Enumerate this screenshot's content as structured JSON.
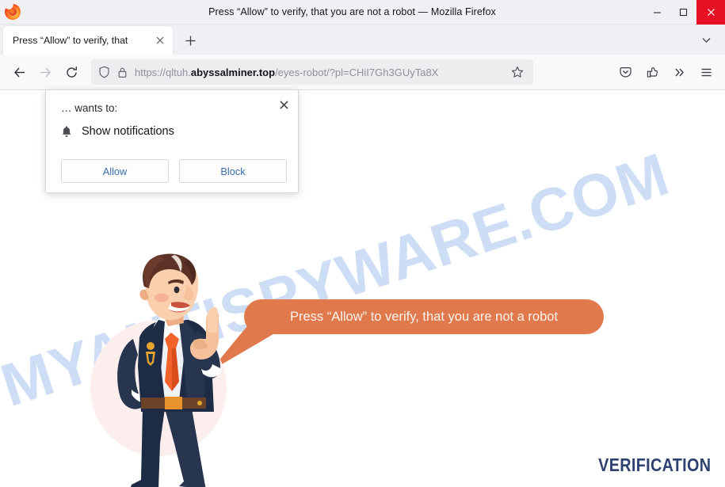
{
  "window": {
    "title": "Press “Allow” to verify, that you are not a robot — Mozilla Firefox",
    "app_icon": "firefox-logo",
    "minimize_label": "Minimize",
    "maximize_label": "Maximize",
    "close_label": "Close",
    "close_button_color": "#e81123"
  },
  "tabbar": {
    "tab_title": "Press “Allow” to verify, that",
    "tab_close_label": "Close tab",
    "new_tab_label": "New tab",
    "list_all_tabs_label": "List all tabs"
  },
  "toolbar": {
    "back_label": "Go back one page",
    "forward_label": "Go forward one page",
    "reload_label": "Reload current page",
    "shield_label": "Tracking protection",
    "lock_label": "Connection secure",
    "bookmark_label": "Bookmark this page",
    "pocket_label": "Save to Pocket",
    "share_label": "Share",
    "overflow_label": "More tools",
    "menu_label": "Open application menu",
    "url": {
      "scheme": "https://",
      "subdomain": "qltuh.",
      "host": "abyssalminer.top",
      "path": "/eyes-robot/?pl=CHiI7Gh3GUyTa8X",
      "full": "https://qltuh.abyssalminer.top/eyes-robot/?pl=CHiI7Gh3GUyTa8X"
    }
  },
  "permission_popup": {
    "origin_text": "… wants to:",
    "permission_icon": "bell-icon",
    "permission_label": "Show notifications",
    "allow_label": "Allow",
    "block_label": "Block",
    "close_label": "Close",
    "button_text_color": "#3a6ea8"
  },
  "page": {
    "watermark": "MYANTISPYWARE.COM",
    "watermark_color": "#c3d6f3",
    "bubble_text": "Press “Allow” to verify, that you are not a robot",
    "bubble_color": "#e07a4c",
    "bubble_text_color": "#fdf3ee",
    "footer_label": "VERIFICATION",
    "footer_color": "#2d4270",
    "character_alt": "cartoon security agent pointing upward"
  }
}
